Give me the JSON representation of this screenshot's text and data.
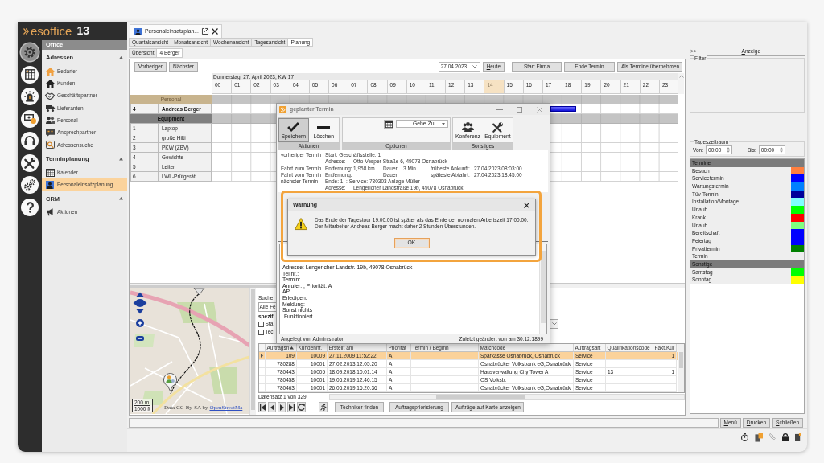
{
  "logo": {
    "name": "esoffice",
    "version": "13"
  },
  "rail": [
    {
      "kind": "gear",
      "selected": true
    },
    {
      "kind": "grid",
      "selected": false
    },
    {
      "kind": "siren",
      "selected": false
    },
    {
      "kind": "cash",
      "selected": false
    },
    {
      "kind": "headset",
      "selected": false
    },
    {
      "kind": "tools",
      "selected": false
    },
    {
      "kind": "gears",
      "selected": false
    },
    {
      "kind": "help",
      "selected": false
    }
  ],
  "nav": {
    "title": "Office",
    "sections": [
      {
        "title": "Adressen",
        "expanded": true,
        "items": [
          {
            "label": "Bedarfer",
            "kind": "orange-house",
            "selected": false
          },
          {
            "label": "Kunden",
            "kind": "house",
            "selected": false
          },
          {
            "label": "Geschäftspartner",
            "kind": "handshake",
            "selected": false
          },
          {
            "label": "Lieferanten",
            "kind": "truck",
            "selected": false
          },
          {
            "label": "Personal",
            "kind": "people",
            "selected": false
          },
          {
            "label": "Ansprechpartner",
            "kind": "speech",
            "selected": false
          },
          {
            "label": "Adressensuche",
            "kind": "search-card",
            "selected": false
          }
        ]
      },
      {
        "title": "Terminplanung",
        "expanded": true,
        "items": [
          {
            "label": "Kalender",
            "kind": "calendar",
            "selected": false
          },
          {
            "label": "Personaleinsatzplanung",
            "kind": "person-badge",
            "selected": true
          }
        ]
      },
      {
        "title": "CRM",
        "expanded": true,
        "items": [
          {
            "label": "Aktionen",
            "kind": "megaphone",
            "selected": false
          }
        ]
      }
    ]
  },
  "document_tab": {
    "title": "Personaleinsatzplan..."
  },
  "view_tabs": [
    {
      "label": "Quartalsansicht",
      "selected": false
    },
    {
      "label": "Monatsansicht",
      "selected": false
    },
    {
      "label": "Wochenansicht",
      "selected": false
    },
    {
      "label": "Tagesansicht",
      "selected": false
    },
    {
      "label": "Planung",
      "selected": true
    }
  ],
  "sub_tabs": [
    {
      "label": "Übersicht",
      "selected": false
    },
    {
      "label": "4 Berger",
      "selected": true
    }
  ],
  "toolbar": {
    "previous": "Vorheriger",
    "next": "Nächster",
    "date": "27.04.2023",
    "today": "Heute",
    "actions": [
      "Start Firma",
      "Ende Termin",
      "Als Termine übernehmen"
    ]
  },
  "planner": {
    "date_label": "Donnerstag, 27. April 2023, KW 17",
    "hours": [
      {
        "label": "00",
        "selected": false
      },
      {
        "label": "01",
        "selected": false
      },
      {
        "label": "02",
        "selected": false
      },
      {
        "label": "03",
        "selected": false
      },
      {
        "label": "04",
        "selected": false
      },
      {
        "label": "05",
        "selected": false
      },
      {
        "label": "06",
        "selected": false
      },
      {
        "label": "07",
        "selected": false
      },
      {
        "label": "08",
        "selected": false
      },
      {
        "label": "09",
        "selected": false
      },
      {
        "label": "10",
        "selected": false
      },
      {
        "label": "11",
        "selected": false
      },
      {
        "label": "12",
        "selected": false
      },
      {
        "label": "13",
        "selected": false
      },
      {
        "label": "14",
        "selected": true
      },
      {
        "label": "15",
        "selected": false
      },
      {
        "label": "16",
        "selected": false
      },
      {
        "label": "17",
        "selected": false
      },
      {
        "label": "18",
        "selected": false
      },
      {
        "label": "19",
        "selected": false
      },
      {
        "label": "20",
        "selected": false
      },
      {
        "label": "21",
        "selected": false
      },
      {
        "label": "22",
        "selected": false
      },
      {
        "label": "23",
        "selected": false
      }
    ],
    "groups": [
      {
        "title": "Personal",
        "kind": "personal",
        "rows": [
          {
            "number": "4",
            "name": "Andreas Berger",
            "scheduled": true
          }
        ]
      },
      {
        "title": "Equipment",
        "kind": "equipment",
        "rows": [
          {
            "number": "1",
            "name": "Laptop",
            "scheduled": false
          },
          {
            "number": "2",
            "name": "große Hilti",
            "scheduled": false
          },
          {
            "number": "3",
            "name": "PKW (ZBV)",
            "scheduled": false
          },
          {
            "number": "4",
            "name": "Gewichte",
            "scheduled": false
          },
          {
            "number": "5",
            "name": "Leiter",
            "scheduled": false
          },
          {
            "number": "6",
            "name": "LWL-Prüfgerät",
            "scheduled": false
          }
        ]
      }
    ]
  },
  "map": {
    "scale": [
      "200 m",
      "1000 ft"
    ],
    "attribution": "Data CC-By-SA by",
    "link": "OpenStreetMa"
  },
  "search": {
    "label": "Suche",
    "field": "Alle Fe",
    "group_label": "spezifi",
    "checks": [
      {
        "label": "Sta",
        "checked": false
      },
      {
        "label": "Tec",
        "checked": false
      }
    ]
  },
  "orders": {
    "columns": [
      {
        "label": "Auftragsn",
        "sorted": true
      },
      {
        "label": "Kundennr.",
        "sorted": false
      },
      {
        "label": "Erstellt am",
        "sorted": false
      },
      {
        "label": "Priorität",
        "sorted": false
      },
      {
        "label": "Termin / Beginn",
        "sorted": false
      },
      {
        "label": "Matchcode",
        "sorted": false
      },
      {
        "label": "Auftragsart",
        "sorted": false
      },
      {
        "label": "Qualifikationscode",
        "sorted": false
      },
      {
        "label": "Fakt.Kur",
        "sorted": false
      }
    ],
    "rows": [
      {
        "selected": true,
        "cells": [
          "109",
          "10009",
          "27.11.2009 11:52:22",
          "A",
          null,
          "Sparkasse Osnabrück, Osnabrück",
          "Service",
          null,
          "1"
        ]
      },
      {
        "selected": false,
        "cells": [
          "780288",
          "10001",
          "27.02.2013 12:05:20",
          "A",
          null,
          "Osnabrücker Volksbank eG,Osnabrück",
          "Service",
          null,
          null
        ]
      },
      {
        "selected": false,
        "cells": [
          "780443",
          "10005",
          "18.09.2018 10:01:14",
          "A",
          null,
          "Hausverwaltung City Tower A",
          "Service",
          "13",
          "1"
        ]
      },
      {
        "selected": false,
        "cells": [
          "780458",
          "10001",
          "19.06.2019 12:46:15",
          "A",
          null,
          "OS Volksb.",
          "Service",
          null,
          null
        ]
      },
      {
        "selected": false,
        "cells": [
          "780463",
          "10001",
          "26.06.2019 16:20:36",
          "A",
          null,
          "Osnabrücker Volksbank eG,Osnabrück",
          "Service",
          null,
          null
        ]
      }
    ],
    "record": "Datensatz 1 von 329",
    "actions": [
      "Techniker finden",
      "Auftragspriorisierung",
      "Aufträge auf Karte anzeigen"
    ]
  },
  "dialog": {
    "title": "geplanter Termin",
    "ribbon": [
      {
        "label": "Aktionen",
        "items": [
          {
            "kind": "save",
            "label": "Speichern",
            "pressed": true
          },
          {
            "kind": "delete",
            "label": "Löschen",
            "pressed": false
          }
        ]
      },
      {
        "label": "Optionen",
        "items": [
          {
            "kind": "calendar"
          },
          {
            "kind": "dropdown",
            "label": "Gehe Zu"
          }
        ]
      },
      {
        "label": "Sonstiges",
        "items": [
          {
            "kind": "conference",
            "label": "Konferenz",
            "pressed": false
          },
          {
            "kind": "equipment",
            "label": "Equipment",
            "pressed": false
          }
        ]
      }
    ],
    "info": [
      {
        "heading": "vorheriger Termin",
        "detail": "Start: Geschäftsstelle: 1"
      },
      {
        "key": "Adresse:",
        "value": "Otto-Vesper-Straße 6, 49078 Osnabrück"
      },
      {
        "heading": "Fahrt zum Termin",
        "key": "Entfernung:",
        "value": "1,958 km",
        "key2": "Dauer:",
        "value2": "3 Min.",
        "key3": "früheste Ankunft:",
        "value3": "27.04.2023 08:03:00"
      },
      {
        "heading": "Fahrt vom Termin",
        "key": "Entfernung:",
        "key2": "Dauer:",
        "key3": "späteste Abfahrt:",
        "value3": "27.04.2023 18:45:00"
      },
      {
        "heading": "nächster Termin",
        "detail": "Ende: 1. : Service: 780303 Anlage Müller"
      },
      {
        "key": "Adresse:",
        "value": "Lengericher Landstraße 19b, 49078 Osnabrück"
      }
    ],
    "notes": [
      "Adresse: Lengericher Landstr. 19b, 49078 Osnabrück",
      "Tel.nr.:",
      "Termin:",
      "Anrufer: , Priorität: A",
      "AP",
      "Erledigen:",
      "Meldung:",
      "Sonst nichts",
      " Funktioniert"
    ],
    "created": "Angelegt von Administrator",
    "modified": "Zuletzt geändert von am 30.12.1899"
  },
  "warning": {
    "title": "Warnung",
    "message": [
      "Das Ende der Tagestour 19:00:00 ist später als das Ende der normalen Arbeitszeit 17:00:00.",
      "Der Mitarbeiter Andreas Berger macht daher 2 Stunden Überstunden."
    ],
    "button": "OK",
    "focused": true
  },
  "side_panel": {
    "toggle": ">>",
    "title": "Anzeige",
    "filter_title": "Filter",
    "time_range": {
      "title": "Tageszeitraum",
      "from_label": "Von:",
      "from": "00:00",
      "to_label": "Bis:",
      "to": "00:00"
    },
    "legend": [
      {
        "title": "Termine",
        "items": [
          {
            "label": "Besuch",
            "color": "#ff7f3f"
          },
          {
            "label": "Servicetermin",
            "color": "#0000ff"
          },
          {
            "label": "Wartungstermin",
            "color": "#0080ff"
          },
          {
            "label": "Tüv-Termin",
            "color": "#00009a"
          },
          {
            "label": "Installation/Montage",
            "color": "#80ffff"
          },
          {
            "label": "Urlaub",
            "color": "#00ff00"
          },
          {
            "label": "Krank",
            "color": "#ff0000"
          },
          {
            "label": "Urlaub",
            "color": "#80ff80"
          },
          {
            "label": "Bereitschaft",
            "color": "#0000ff"
          },
          {
            "label": "Feiertag",
            "color": "#0000ff"
          },
          {
            "label": "Privattermin",
            "color": "#008000"
          },
          {
            "label": "Termin"
          }
        ]
      },
      {
        "title": "Sonstige",
        "items": [
          {
            "label": "Samstag",
            "color": "#00ff00"
          },
          {
            "label": "Sonntag",
            "color": "#ffff00"
          }
        ]
      }
    ]
  },
  "footer_buttons": [
    "Menü",
    "Drucken",
    "Schließen"
  ]
}
